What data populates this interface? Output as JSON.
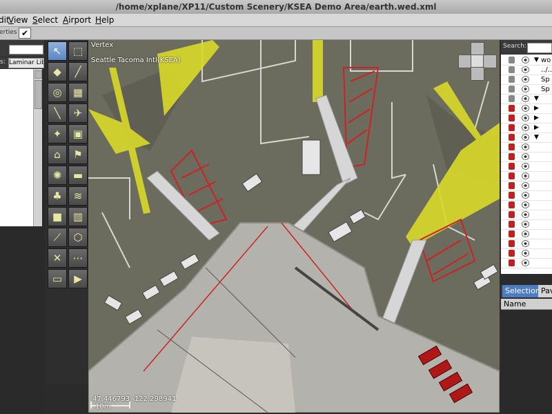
{
  "window": {
    "title": "/home/xplane/XP11/Custom Scenery/KSEA Demo Area/earth.wed.xml"
  },
  "menu": {
    "items": [
      {
        "label": "Edit",
        "underline": "E",
        "rest": "dit"
      },
      {
        "label": "View",
        "underline": "V",
        "rest": "iew"
      },
      {
        "label": "Select",
        "underline": "S",
        "rest": "elect"
      },
      {
        "label": "Airport",
        "underline": "A",
        "rest": "irport"
      },
      {
        "label": "Help",
        "underline": "H",
        "rest": "elp"
      }
    ]
  },
  "toolbar": {
    "properties_label": "erties",
    "properties_checked": "✔"
  },
  "library": {
    "filter_label": "s:",
    "filter_value": "Laminar Lib"
  },
  "tools": [
    "vertex-tool",
    "marquee-tool",
    "taxiway-tool",
    "runway-tool",
    "helipad-tool",
    "boundary-tool",
    "taxi-line-tool",
    "ramp-start-tool",
    "light-fixture-tool",
    "sign-tool",
    "tower-viewpoint-tool",
    "windsock-tool",
    "beacon-tool",
    "truck-tool",
    "forest-tool",
    "atc-tool",
    "object-tool",
    "facade-tool",
    "line-tool",
    "polygon-tool",
    "exclusion-tool",
    "string-tool",
    "truck-parking-tool",
    "truck-dest-tool"
  ],
  "map": {
    "tool_name": "Vertex",
    "airport_name": "Seattle Tacoma Intl(KSEA)",
    "coordinates": "47.446793 -122.298941",
    "scale_label": "10m"
  },
  "hierarchy": {
    "search_label": "Search:",
    "rows": [
      {
        "expander": "▼",
        "label": "wo"
      },
      {
        "expander": "",
        "label": "../.."
      },
      {
        "expander": "",
        "label": "Sp"
      },
      {
        "expander": "",
        "label": "Sp"
      },
      {
        "expander": "▼",
        "label": ""
      },
      {
        "expander": "▶",
        "label": ""
      },
      {
        "expander": "▶",
        "label": ""
      },
      {
        "expander": "▶",
        "label": ""
      },
      {
        "expander": "▼",
        "label": ""
      }
    ],
    "tabs": [
      "Selection",
      "Pav"
    ],
    "column_header": "Name"
  },
  "colors": {
    "accent_selected": "#4c7cc4",
    "ground": "#6c6c5e",
    "aircraft": "#d9d92a",
    "parking_hatch": "#cc2222",
    "terminal": "#b4b2ac"
  }
}
